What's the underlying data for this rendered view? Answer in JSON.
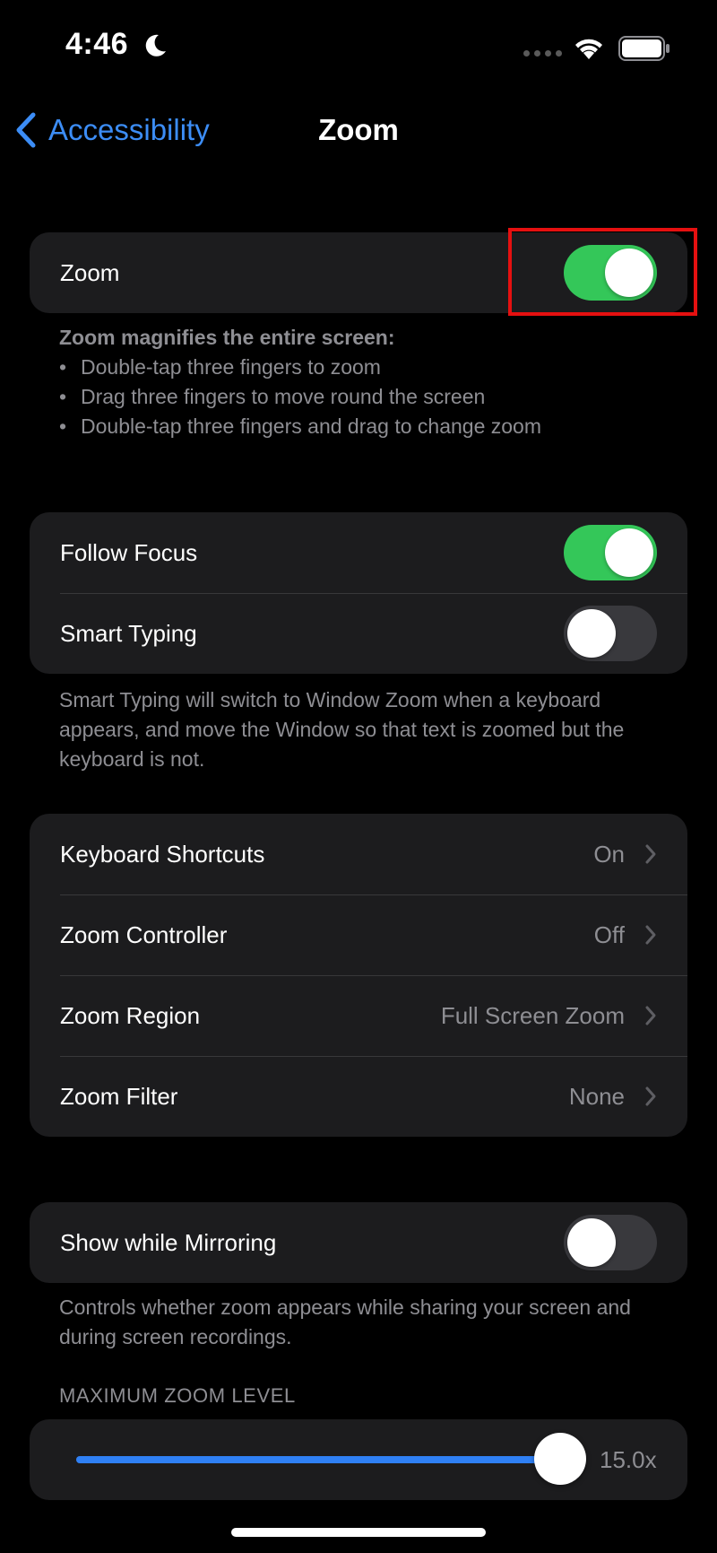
{
  "status_bar": {
    "time": "4:46",
    "icons": [
      "moon-icon",
      "cellular-icon",
      "wifi-icon",
      "battery-icon"
    ]
  },
  "nav": {
    "back_label": "Accessibility",
    "title": "Zoom",
    "back_icon": "chevron-left-icon"
  },
  "zoom_group": {
    "label": "Zoom",
    "toggle_on": true
  },
  "zoom_footnote": {
    "title": "Zoom magnifies the entire screen:",
    "bullets": [
      "Double-tap three fingers to zoom",
      "Drag three fingers to move round the screen",
      "Double-tap three fingers and drag to change zoom"
    ]
  },
  "focus_group": {
    "follow_focus": {
      "label": "Follow Focus",
      "toggle_on": true
    },
    "smart_typing": {
      "label": "Smart Typing",
      "toggle_on": false
    }
  },
  "smart_typing_footnote": "Smart Typing will switch to Window Zoom when a keyboard appears, and move the Window so that text is zoomed but the keyboard is not.",
  "options_group": {
    "items": [
      {
        "label": "Keyboard Shortcuts",
        "value": "On"
      },
      {
        "label": "Zoom Controller",
        "value": "Off"
      },
      {
        "label": "Zoom Region",
        "value": "Full Screen Zoom"
      },
      {
        "label": "Zoom Filter",
        "value": "None"
      }
    ]
  },
  "mirroring_group": {
    "label": "Show while Mirroring",
    "toggle_on": false
  },
  "mirroring_footnote": "Controls whether zoom appears while sharing your screen and during screen recordings.",
  "max_zoom": {
    "header": "MAXIMUM ZOOM LEVEL",
    "value_label": "15.0x",
    "fraction": 1.0
  },
  "colors": {
    "accent_blue": "#3c8df6",
    "toggle_green": "#34c759",
    "slider_blue": "#2f80f5",
    "highlight_red": "#e51010",
    "group_bg": "#1c1c1e"
  }
}
